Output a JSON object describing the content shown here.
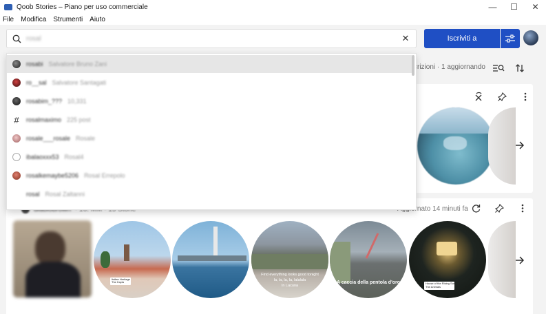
{
  "window": {
    "title": "Qoob Stories – Piano per uso commerciale",
    "minimize": "—",
    "maximize": "☐",
    "close": "✕"
  },
  "menu": [
    "File",
    "Modifica",
    "Strumenti",
    "Aiuto"
  ],
  "search": {
    "value": "rosal",
    "clear": "✕"
  },
  "header": {
    "subscribe_label": "Iscriviti a",
    "status": "scrizioni · 1 aggiornando"
  },
  "dropdown": {
    "items": [
      {
        "name": "rosabi",
        "sub": "Salvatore Bruno Zani",
        "avatar": "photo",
        "color": "#3a3a3a"
      },
      {
        "name": "ro__sal",
        "sub": "Salvatore Santagati",
        "avatar": "photo",
        "color": "#7a1f1f"
      },
      {
        "name": "rosabim_???",
        "sub": "10,331",
        "avatar": "photo",
        "color": "#222222"
      },
      {
        "name": "rosalmaximo",
        "sub": "225 post",
        "avatar": "hashtag",
        "color": "#ffffff"
      },
      {
        "name": "rosale___rosale",
        "sub": "Rosale",
        "avatar": "photo",
        "color": "#c08080"
      },
      {
        "name": "ibalaoxxx53",
        "sub": "Rosal4",
        "avatar": "empty",
        "color": "#ffffff"
      },
      {
        "name": "rosalkemaybe5206",
        "sub": "Rosal Errepolo",
        "avatar": "photo",
        "color": "#b05040"
      },
      {
        "name": "rosal",
        "sub": "Rosal Zaltanni",
        "avatar": "none",
        "color": "#ffffff"
      }
    ]
  },
  "card2": {
    "username": "diabiobrown",
    "meta": "· 16. MM · 15 Storie",
    "updated": "Aggiornato 14 minuti fa"
  },
  "stories_card2": [
    {
      "label": "",
      "tag": "Italian Heritage\nThe Kayla"
    },
    {
      "label": "",
      "tag": ""
    },
    {
      "label": "Find everything looks good tonight\nla, la, la, la, lalalala\nIn Lacuna",
      "tag": ""
    },
    {
      "label": "A caccia della pentola d'oro",
      "tag": ""
    },
    {
      "label": "",
      "tag": "House of the Rising Sun\nThe Animals"
    }
  ]
}
